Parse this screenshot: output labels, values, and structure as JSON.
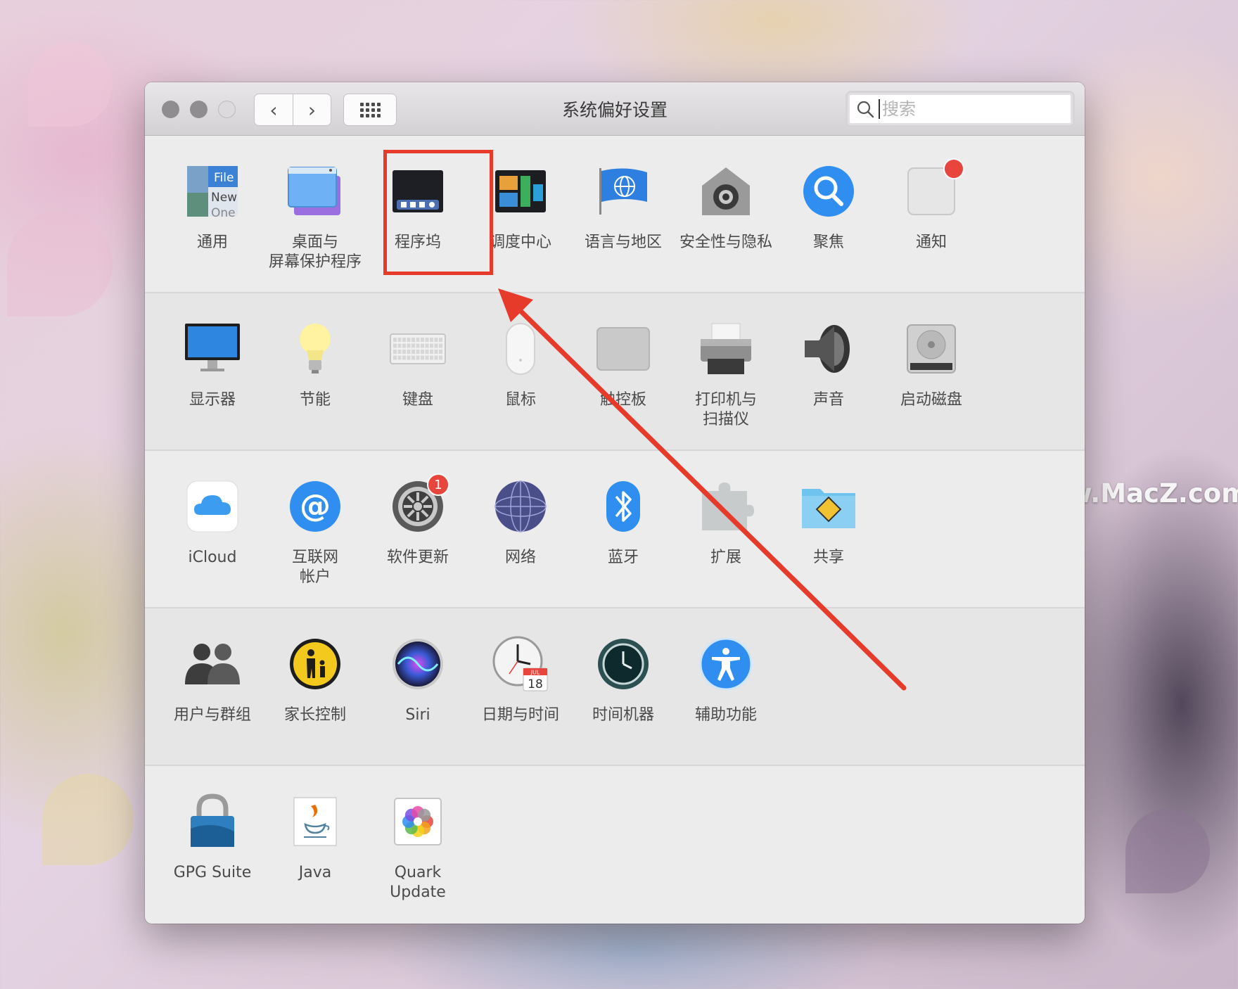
{
  "window": {
    "title": "系统偏好设置",
    "search_placeholder": "搜索"
  },
  "nav": {
    "back": "‹",
    "forward": "›"
  },
  "sections": [
    {
      "items": [
        {
          "label": "通用",
          "icon": "general-icon"
        },
        {
          "label": "桌面与\n屏幕保护程序",
          "icon": "desktop-screensaver-icon"
        },
        {
          "label": "程序坞",
          "icon": "dock-icon"
        },
        {
          "label": "调度中心",
          "icon": "mission-control-icon"
        },
        {
          "label": "语言与地区",
          "icon": "language-region-icon"
        },
        {
          "label": "安全性与隐私",
          "icon": "security-privacy-icon"
        },
        {
          "label": "聚焦",
          "icon": "spotlight-icon"
        },
        {
          "label": "通知",
          "icon": "notifications-icon"
        }
      ]
    },
    {
      "items": [
        {
          "label": "显示器",
          "icon": "displays-icon"
        },
        {
          "label": "节能",
          "icon": "energy-saver-icon"
        },
        {
          "label": "键盘",
          "icon": "keyboard-icon"
        },
        {
          "label": "鼠标",
          "icon": "mouse-icon"
        },
        {
          "label": "触控板",
          "icon": "trackpad-icon"
        },
        {
          "label": "打印机与\n扫描仪",
          "icon": "printers-scanners-icon"
        },
        {
          "label": "声音",
          "icon": "sound-icon"
        },
        {
          "label": "启动磁盘",
          "icon": "startup-disk-icon"
        }
      ]
    },
    {
      "items": [
        {
          "label": "iCloud",
          "icon": "icloud-icon"
        },
        {
          "label": "互联网\n帐户",
          "icon": "internet-accounts-icon"
        },
        {
          "label": "软件更新",
          "icon": "software-update-icon",
          "badge": "1"
        },
        {
          "label": "网络",
          "icon": "network-icon"
        },
        {
          "label": "蓝牙",
          "icon": "bluetooth-icon"
        },
        {
          "label": "扩展",
          "icon": "extensions-icon"
        },
        {
          "label": "共享",
          "icon": "sharing-icon"
        }
      ]
    },
    {
      "items": [
        {
          "label": "用户与群组",
          "icon": "users-groups-icon"
        },
        {
          "label": "家长控制",
          "icon": "parental-controls-icon"
        },
        {
          "label": "Siri",
          "icon": "siri-icon"
        },
        {
          "label": "日期与时间",
          "icon": "date-time-icon"
        },
        {
          "label": "时间机器",
          "icon": "time-machine-icon"
        },
        {
          "label": "辅助功能",
          "icon": "accessibility-icon"
        }
      ]
    },
    {
      "items": [
        {
          "label": "GPG Suite",
          "icon": "gpg-suite-icon"
        },
        {
          "label": "Java",
          "icon": "java-icon"
        },
        {
          "label": "Quark\nUpdate",
          "icon": "quark-update-icon"
        }
      ]
    }
  ],
  "date_icon_text": {
    "month": "JUL",
    "day": "18"
  },
  "general_icon_text": [
    "File",
    "New",
    "One"
  ],
  "watermark": "www.MacZ.com",
  "watermark_logo": "Z",
  "colors": {
    "annotation": "#e63a2b",
    "badge": "#e8453c"
  }
}
